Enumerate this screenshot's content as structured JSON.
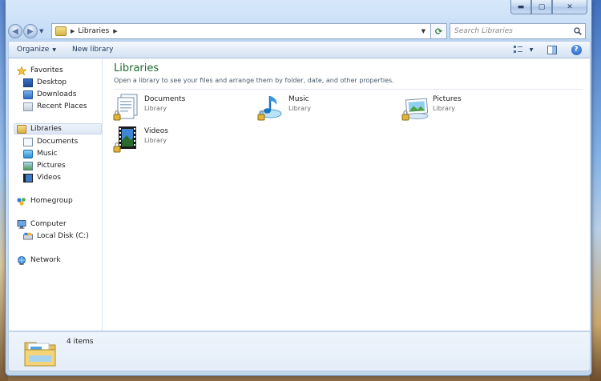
{
  "window": {
    "caption": {
      "minimize": "▬",
      "maximize": "▢",
      "close": "✕"
    }
  },
  "nav": {
    "breadcrumb": "Libraries",
    "search_placeholder": "Search Libraries"
  },
  "toolbar": {
    "organize": "Organize",
    "new_library": "New library"
  },
  "sidebar": {
    "favorites": {
      "label": "Favorites",
      "items": [
        "Desktop",
        "Downloads",
        "Recent Places"
      ]
    },
    "libraries": {
      "label": "Libraries",
      "items": [
        "Documents",
        "Music",
        "Pictures",
        "Videos"
      ]
    },
    "homegroup": "Homegroup",
    "computer": {
      "label": "Computer",
      "items": [
        "Local Disk (C:)"
      ]
    },
    "network": "Network"
  },
  "main": {
    "title": "Libraries",
    "subtitle": "Open a library to see your files and arrange them by folder, date, and other properties.",
    "items": [
      {
        "name": "Documents",
        "type": "Library",
        "icon": "documents-library-icon"
      },
      {
        "name": "Music",
        "type": "Library",
        "icon": "music-library-icon"
      },
      {
        "name": "Pictures",
        "type": "Library",
        "icon": "pictures-library-icon"
      },
      {
        "name": "Videos",
        "type": "Library",
        "icon": "videos-library-icon"
      }
    ]
  },
  "details": {
    "count": "4 items"
  },
  "colors": {
    "accent_title": "#1e6a2e",
    "selection": "#dde7f4"
  }
}
